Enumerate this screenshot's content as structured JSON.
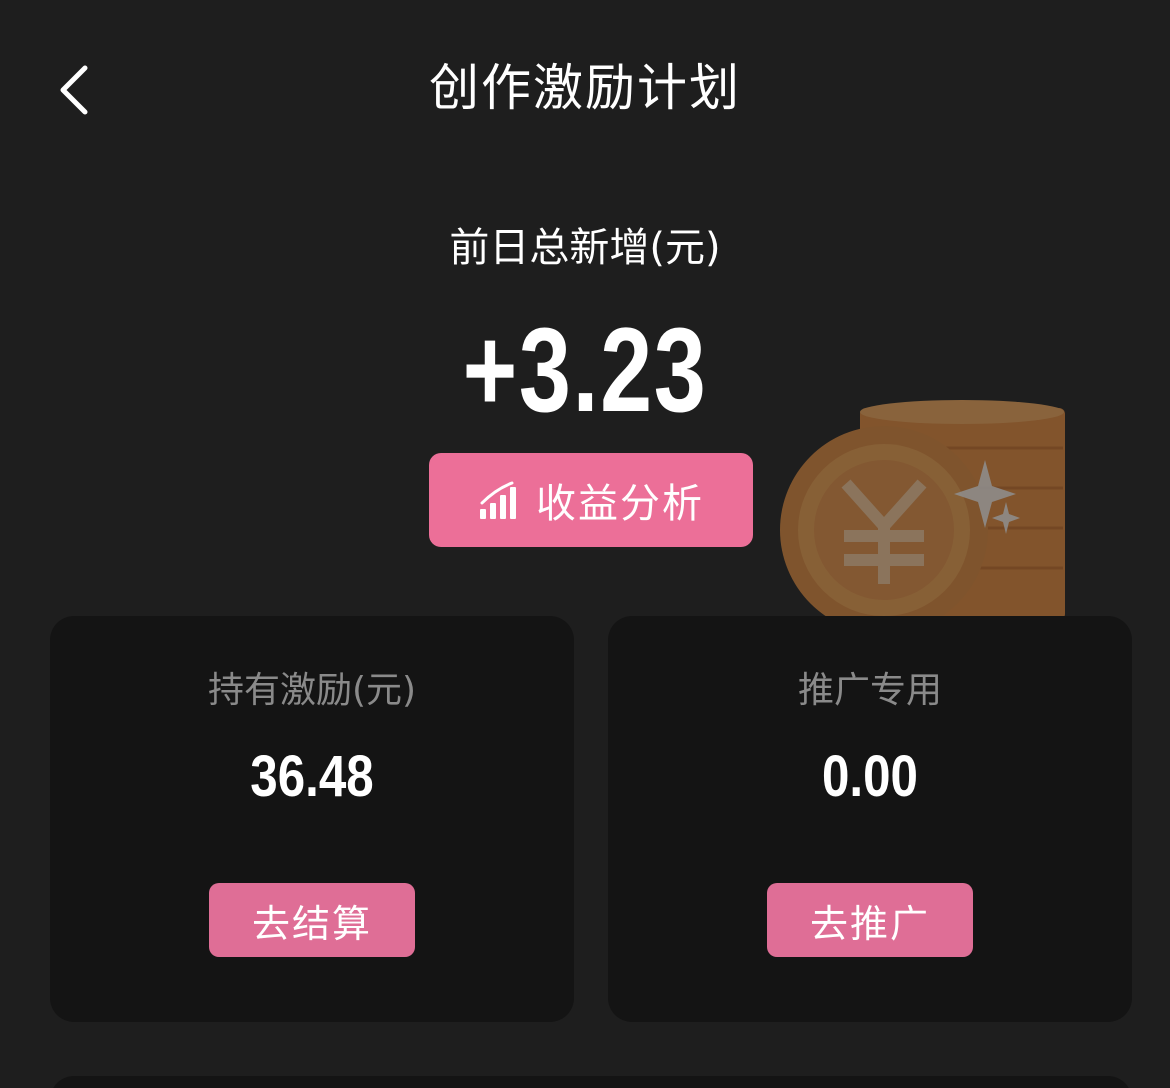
{
  "header": {
    "title": "创作激励计划",
    "back_icon": "chevron-left-icon"
  },
  "summary": {
    "label": "前日总新增(元)",
    "value": "+3.23",
    "analysis_button": {
      "icon": "signal-bars-icon",
      "label": "收益分析"
    },
    "illustration": "coin-stack-yuan-icon"
  },
  "cards": [
    {
      "title": "持有激励(元)",
      "value": "36.48",
      "button_label": "去结算"
    },
    {
      "title": "推广专用",
      "value": "0.00",
      "button_label": "去推广"
    }
  ],
  "colors": {
    "background": "#1e1e1e",
    "card": "#141414",
    "accent": "#ec6f98",
    "muted_text": "#8a8a8a"
  }
}
